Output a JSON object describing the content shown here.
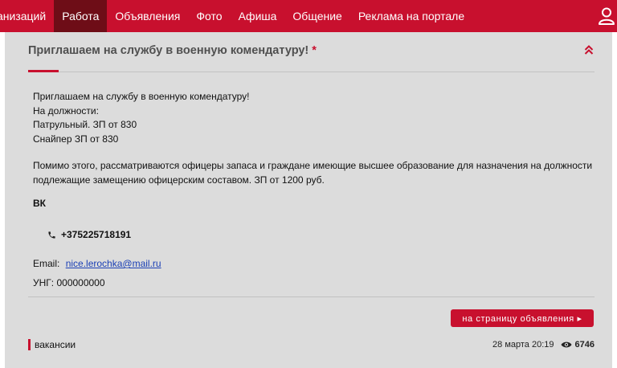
{
  "nav": {
    "items": [
      {
        "label": "анизаций"
      },
      {
        "label": "Работа"
      },
      {
        "label": "Объявления"
      },
      {
        "label": "Фото"
      },
      {
        "label": "Афиша"
      },
      {
        "label": "Общение"
      },
      {
        "label": "Реклама на портале"
      }
    ],
    "active_index": 1,
    "user_icon": "user-icon"
  },
  "post": {
    "title": "Приглашаем на службу в военную комендатуру!",
    "title_mark": "*",
    "collapse_icon": "chevron-up-double-icon",
    "body": {
      "line1": "Приглашаем на службу в военную комендатуру!",
      "line2": "На должности:",
      "line3": "Патрульный. ЗП от 830",
      "line4": "Снайпер ЗП от 830",
      "para2_line1": "Помимо этого, рассматриваются офицеры запаса и граждане имеющие высшее образование для назначения на должности",
      "para2_line2": "подлежащие замещению офицерским составом. ЗП от 1200 руб."
    },
    "vk": "ВК",
    "phone": "+375225718191",
    "email_label": "Email:",
    "email": "nice.lerochka@mail.ru",
    "unp_label": "УНГ:",
    "unp": "000000000",
    "button_label": "на страницу объявления ▸",
    "tag": "вакансии",
    "date": "28 марта 20:19",
    "views": "6746"
  },
  "colors": {
    "accent": "#c8102e",
    "nav_active": "#6e0d17",
    "card_bg": "#dcdcdc",
    "link": "#1a3fb5"
  }
}
